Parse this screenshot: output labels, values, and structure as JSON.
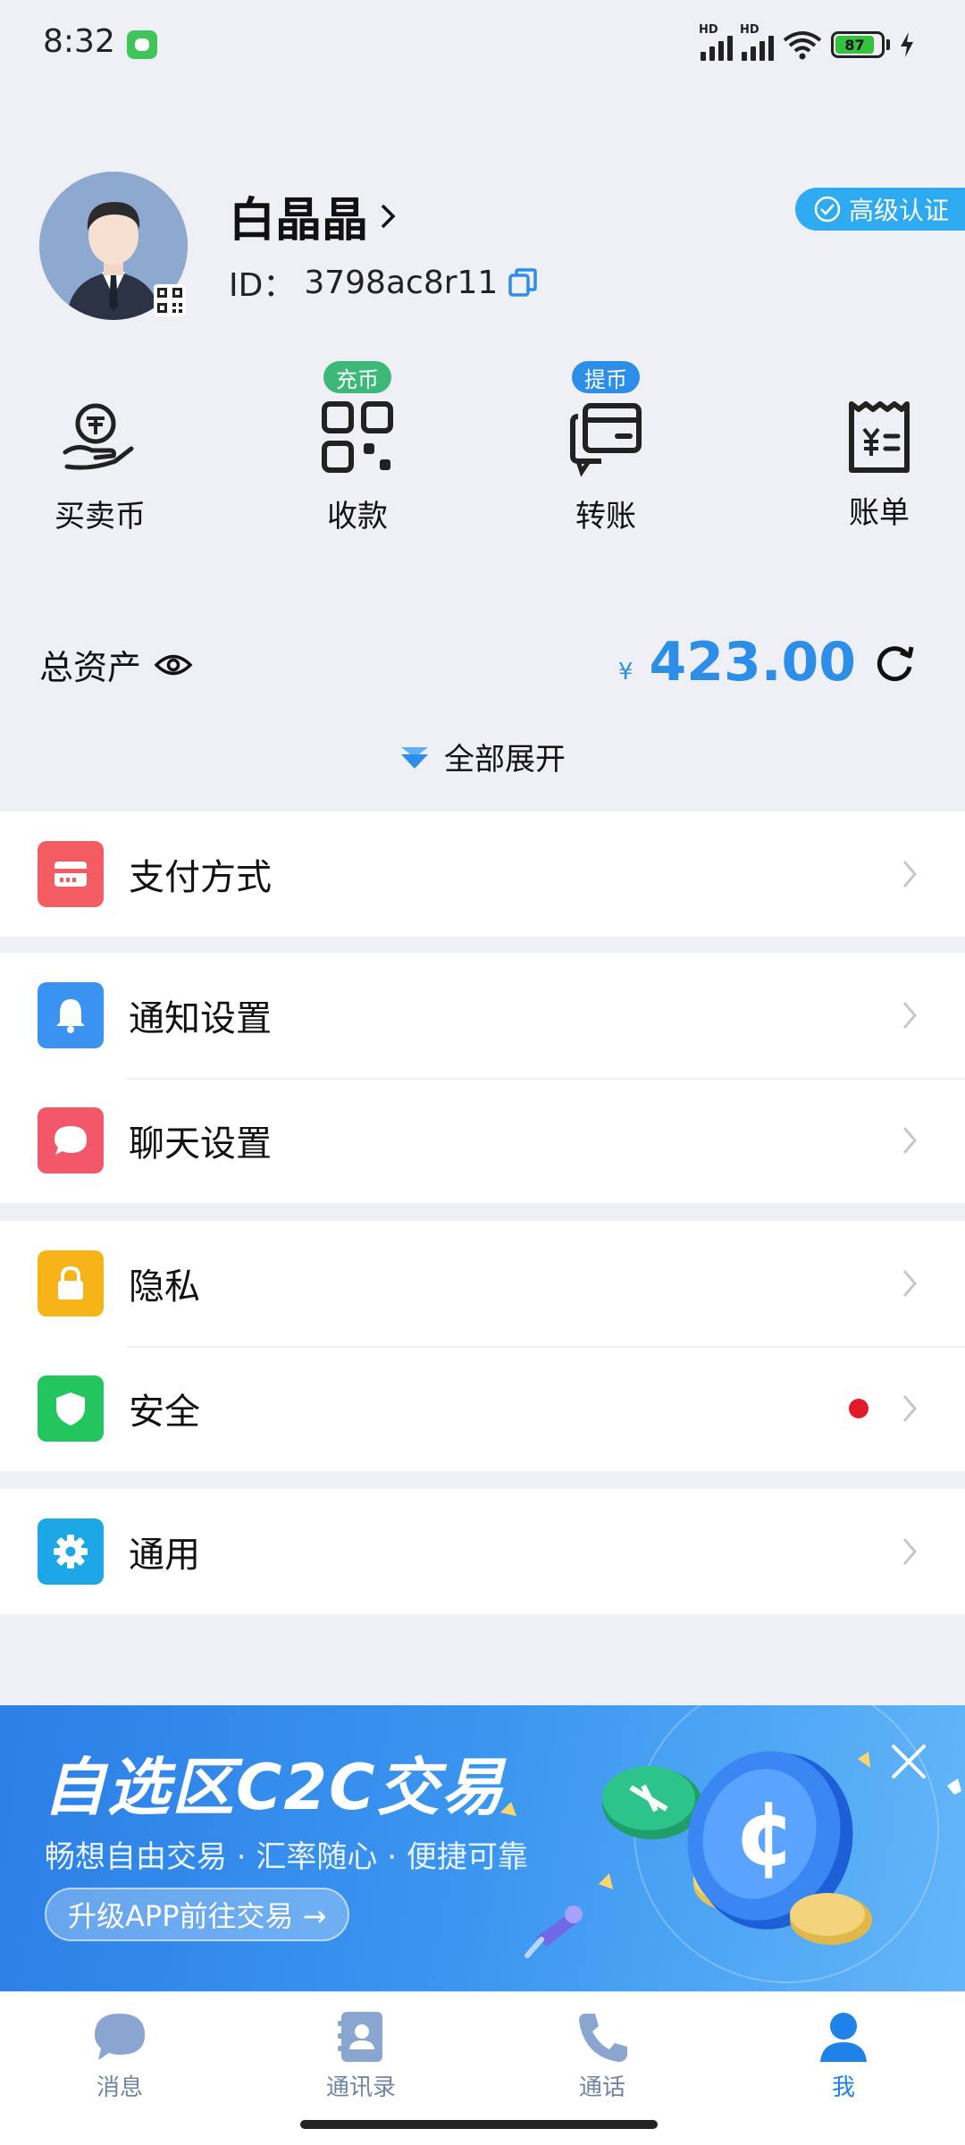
{
  "status_bar": {
    "time": "8:32",
    "signal1_label": "HD",
    "signal2_label": "HD",
    "battery_level": "87"
  },
  "profile": {
    "name": "白晶晶",
    "id_label": "ID：",
    "id_value": "3798ac8r11",
    "verify_badge": "高级认证"
  },
  "actions": [
    {
      "label": "买卖币",
      "tag": "",
      "icon": "coin-hand-icon"
    },
    {
      "label": "收款",
      "tag": "充币",
      "icon": "qr-code-icon"
    },
    {
      "label": "转账",
      "tag": "提币",
      "icon": "transfer-card-icon"
    },
    {
      "label": "账单",
      "tag": "",
      "icon": "bill-receipt-icon"
    }
  ],
  "assets": {
    "label": "总资产",
    "currency": "¥",
    "amount": "423.00",
    "expand_label": "全部展开"
  },
  "settings": {
    "payment": "支付方式",
    "notify": "通知设置",
    "chat": "聊天设置",
    "privacy": "隐私",
    "security": "安全",
    "general": "通用"
  },
  "banner": {
    "title": "自选区C2C交易",
    "subtitle": "畅想自由交易 · 汇率随心 · 便捷可靠",
    "button": "升级APP前往交易 →"
  },
  "bottom_nav": [
    {
      "label": "消息",
      "icon": "chat-bubble-icon",
      "active": false
    },
    {
      "label": "通讯录",
      "icon": "contacts-icon",
      "active": false
    },
    {
      "label": "通话",
      "icon": "phone-icon",
      "active": false
    },
    {
      "label": "我",
      "icon": "person-icon",
      "active": true
    }
  ],
  "colors": {
    "accent": "#2d8ee8",
    "badge_green": "#3cb878",
    "badge_blue": "#2d8ee8",
    "security_dot": "#e21b2b"
  }
}
